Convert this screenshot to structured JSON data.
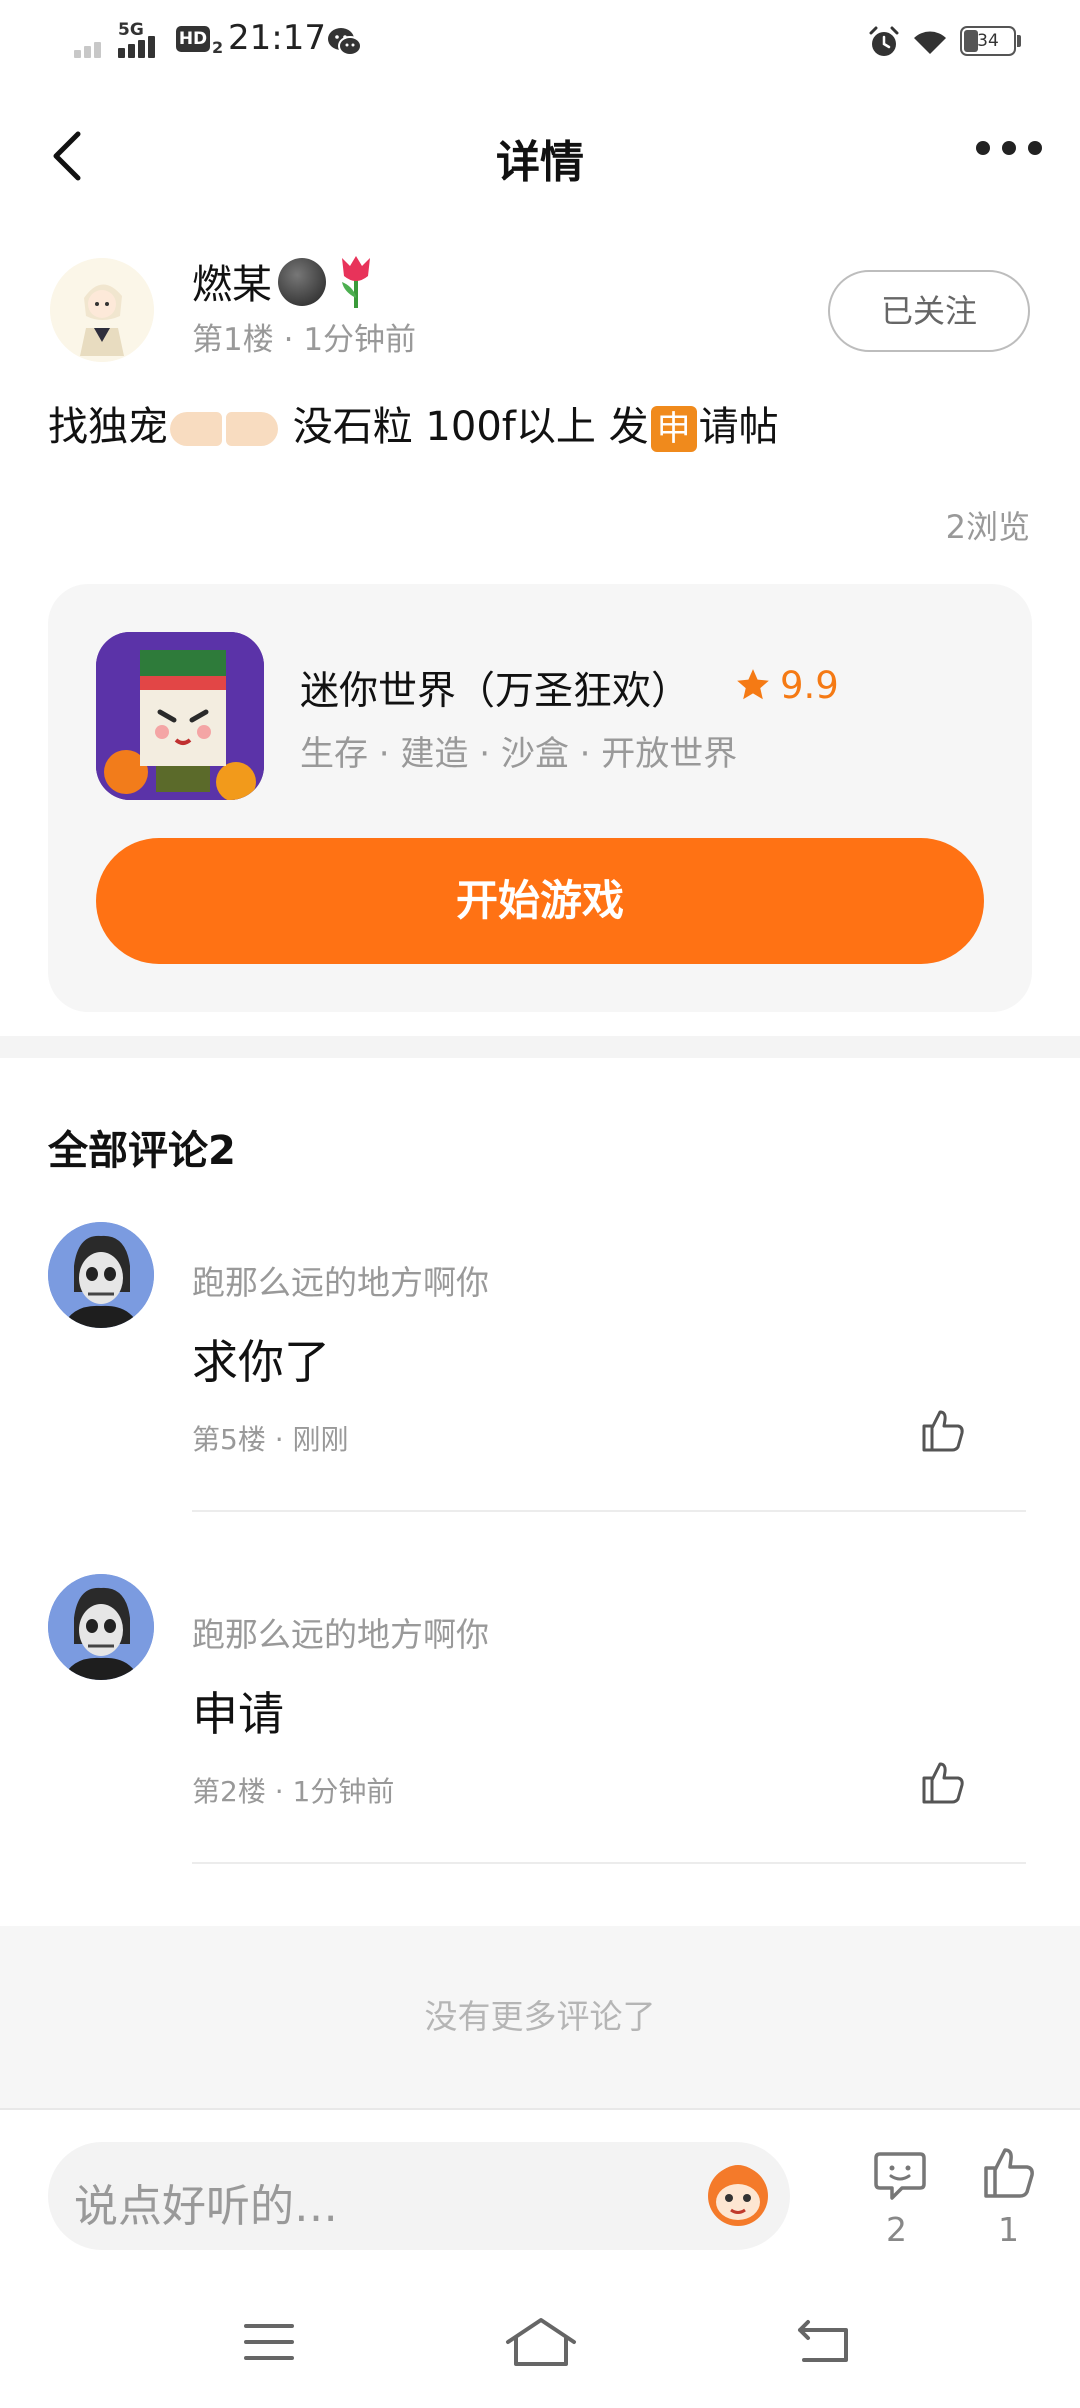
{
  "status_bar": {
    "time": "21:17",
    "network": "5G",
    "hd": "HD",
    "hd_sub": "2",
    "battery": "34",
    "icons": [
      "signal-icon",
      "wechat-icon",
      "alarm-icon",
      "wifi-icon",
      "battery-icon"
    ]
  },
  "header": {
    "title": "详情",
    "back_icon": "chevron-left-icon",
    "more_icon": "more-dots-icon"
  },
  "post": {
    "author": "燃某",
    "floor": "第1楼",
    "time": "1分钟前",
    "follow_label": "已关注",
    "text_part1": "找独宠",
    "text_part2": " 没石粒 100f以上 发",
    "text_badge": "申",
    "text_part3": "请帖",
    "views": "2浏览"
  },
  "game_card": {
    "name": "迷你世界（万圣狂欢）",
    "rating": "9.9",
    "tags": "生存 · 建造 · 沙盒 · 开放世界",
    "play_label": "开始游戏",
    "accent": "#ff7214"
  },
  "comments": {
    "header": "全部评论2",
    "items": [
      {
        "user": "跑那么远的地方啊你",
        "body": "求你了",
        "floor": "第5楼",
        "time": "刚刚"
      },
      {
        "user": "跑那么远的地方啊你",
        "body": "申请",
        "floor": "第2楼",
        "time": "1分钟前"
      }
    ],
    "no_more": "没有更多评论了"
  },
  "bottom_bar": {
    "input_placeholder": "说点好听的…",
    "comment_count": "2",
    "like_count": "1"
  },
  "nav_bar": {
    "icons": [
      "menu-icon",
      "home-icon",
      "back-icon"
    ]
  }
}
